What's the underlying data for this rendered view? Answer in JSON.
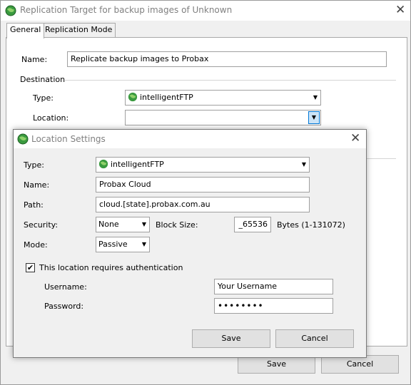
{
  "window": {
    "title": "Replication Target for backup images of Unknown",
    "tabs": [
      "General",
      "Replication Mode"
    ],
    "name_label": "Name:",
    "name_value": "Replicate backup images to Probax",
    "destination_label": "Destination",
    "type_label": "Type:",
    "type_value": "intelligentFTP",
    "location_label": "Location:",
    "location_value": "",
    "save_label": "Save",
    "cancel_label": "Cancel"
  },
  "dialog": {
    "title": "Location Settings",
    "type_label": "Type:",
    "type_value": "intelligentFTP",
    "name_label": "Name:",
    "name_value": "Probax Cloud",
    "path_label": "Path:",
    "path_value": "cloud.[state].probax.com.au",
    "security_label": "Security:",
    "security_value": "None",
    "block_size_label": "Block Size:",
    "block_size_value": "_65536",
    "bytes_label": "Bytes (1-131072)",
    "mode_label": "Mode:",
    "mode_value": "Passive",
    "auth_checkbox_label": "This location requires authentication",
    "auth_checked": true,
    "username_label": "Username:",
    "username_value": "Your Username",
    "password_label": "Password:",
    "password_value": "••••••••",
    "save_label": "Save",
    "cancel_label": "Cancel"
  },
  "icons": {
    "app": "green-globe-icon",
    "ftp": "globe-icon",
    "close": "close-icon",
    "dropdown": "chevron-down-icon"
  },
  "colors": {
    "accent": "#0078d7",
    "title_text": "#808080",
    "globe_green": "#2e8b3a"
  }
}
